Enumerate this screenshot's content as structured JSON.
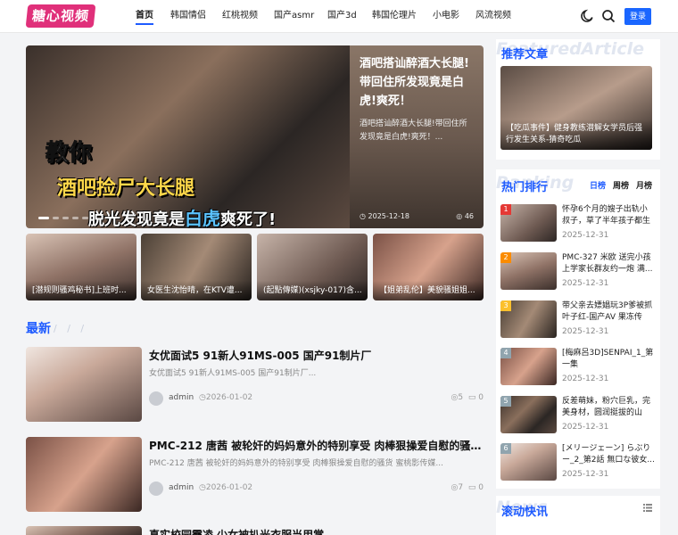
{
  "header": {
    "logo": "糖心视频",
    "nav": [
      "首页",
      "韩国情侣",
      "红桃视频",
      "国产asmr",
      "国产3d",
      "韩国伦理片",
      "小电影",
      "风流视频"
    ],
    "active_nav": "首页",
    "login": "登录",
    "icons": [
      "moon-icon",
      "search-icon"
    ]
  },
  "hero": {
    "overlay_line1": "教你",
    "overlay_line2": "酒吧捡尸大长腿",
    "overlay_line3a": "脱光发现竟是",
    "overlay_line3b": "白虎",
    "overlay_line3c": "爽死了!",
    "side_title": "酒吧搭讪醉酒大长腿!带回住所发现竟是白虎!爽死！",
    "side_desc": "酒吧搭讪醉酒大长腿!带回住所发现竟是白虎!爽死！...",
    "side_date": "2025-12-18",
    "side_views": "46"
  },
  "thumbs": [
    "[潜规则骚鸡秘书]上班时...",
    "女医生沈怡晴，在KTV遭...",
    "(起點傳媒)(xsjky-017)含...",
    "【姐弟乱伦】美貌骚姐姐..."
  ],
  "latest": {
    "title": "最新",
    "slashes": "/ / /",
    "posts": [
      {
        "title": "女优面试5 91新人91MS-005 国产91制片厂",
        "desc": "女优面试5 91新人91MS-005 国产91制片厂...",
        "author": "admin",
        "date": "2026-01-02",
        "views": "5",
        "comments": "0"
      },
      {
        "title": "PMC-212 唐茜 被轮奸的妈妈意外的特别享受 肉棒狠操爱自慰的骚货 蜜桃影...",
        "desc": "PMC-212 唐茜 被轮奸的妈妈意外的特别享受 肉棒狠操爱自慰的骚货 蜜桃影传媒...",
        "author": "admin",
        "date": "2026-01-02",
        "views": "7",
        "comments": "0"
      },
      {
        "title": "真实校园霸凌 少女被扒光衣服当用掌"
      }
    ]
  },
  "sidebar": {
    "recommend_title": "推荐文章",
    "recommend_ghost": "FeaturedArticle",
    "recommend_caption": "【吃瓜事件】健身教练潜解女学员后强行发生关系-猜奇吃瓜",
    "hot_title": "热门排行",
    "hot_ghost": "Ranking",
    "tabs": [
      "日榜",
      "周榜",
      "月榜"
    ],
    "active_tab": "日榜",
    "ranking": [
      {
        "num": "1",
        "title": "怀孕6个月的嫂子出轨小叔子，草了半年孩子都生下...",
        "date": "2025-12-31"
      },
      {
        "num": "2",
        "title": "PMC-327 米欧 送完小孩上学家长群友约一炮 满...",
        "date": "2025-12-31"
      },
      {
        "num": "3",
        "title": "带父亲去嫖娼玩3P爹被抓 叶子红-国产AV 果冻传媒...",
        "date": "2025-12-31"
      },
      {
        "num": "4",
        "title": "[梅麻呂3D]SENPAI_1_第一集",
        "date": "2025-12-31"
      },
      {
        "num": "5",
        "title": "反差萌妹，粉穴巨乳，完美身材，圆润挺拔的山峰，...",
        "date": "2025-12-31"
      },
      {
        "num": "6",
        "title": "[メリージェーン] らぶりー_2_第2話 無口な彼女...",
        "date": "2025-12-31"
      }
    ],
    "news_title": "滚动快讯",
    "news_ghost": "News"
  }
}
